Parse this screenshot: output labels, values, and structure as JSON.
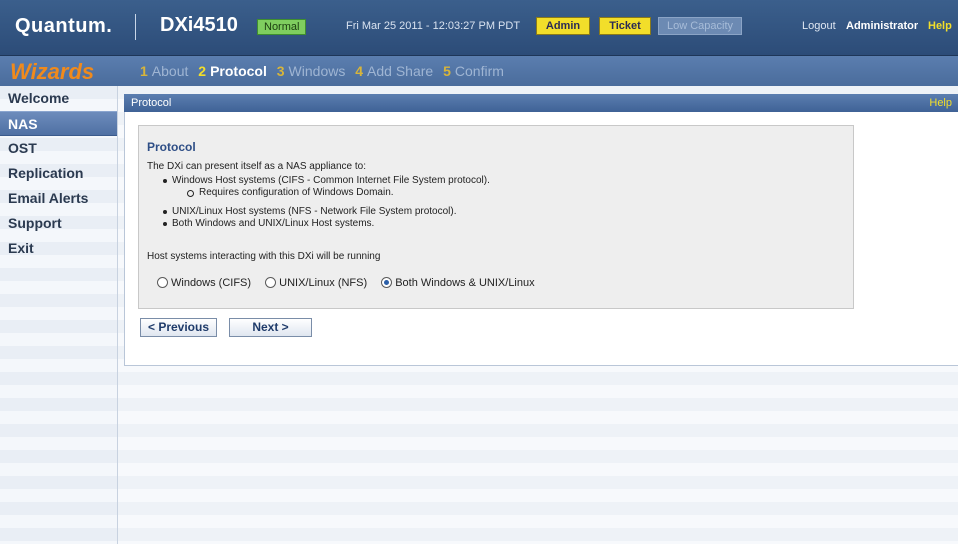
{
  "header": {
    "brand": "Quantum.",
    "model": "DXi4510",
    "status": "Normal",
    "datetime": "Fri Mar 25 2011 - 12:03:27 PM PDT",
    "buttons": {
      "admin": "Admin",
      "ticket": "Ticket",
      "low_capacity": "Low Capacity"
    },
    "logout": "Logout",
    "user": "Administrator",
    "help": "Help"
  },
  "wizard": {
    "title": "Wizards",
    "steps": [
      {
        "num": "1",
        "label": "About"
      },
      {
        "num": "2",
        "label": "Protocol"
      },
      {
        "num": "3",
        "label": "Windows"
      },
      {
        "num": "4",
        "label": "Add Share"
      },
      {
        "num": "5",
        "label": "Confirm"
      }
    ],
    "active_step": "Protocol"
  },
  "sidebar": {
    "items": [
      {
        "label": "Welcome"
      },
      {
        "label": "NAS"
      },
      {
        "label": "OST"
      },
      {
        "label": "Replication"
      },
      {
        "label": "Email Alerts"
      },
      {
        "label": "Support"
      },
      {
        "label": "Exit"
      }
    ],
    "active_item": "NAS"
  },
  "panel": {
    "title": "Protocol",
    "help": "Help",
    "heading": "Protocol",
    "intro": "The DXi can present itself as a NAS appliance to:",
    "bullets": {
      "windows": "Windows Host systems (CIFS - Common Internet File System protocol).",
      "windows_sub": "Requires configuration of Windows Domain.",
      "unix": "UNIX/Linux Host systems (NFS - Network File System protocol).",
      "both": "Both Windows and UNIX/Linux Host systems."
    },
    "running_text": "Host systems interacting with this DXi will be running",
    "options": [
      {
        "label": "Windows (CIFS)",
        "checked": false
      },
      {
        "label": "UNIX/Linux (NFS)",
        "checked": false
      },
      {
        "label": "Both Windows & UNIX/Linux",
        "checked": true
      }
    ],
    "prev_label": "< Previous",
    "next_label": "Next >"
  },
  "colors": {
    "header_blue": "#2c4c78",
    "wizard_orange": "#f08a1c",
    "badge_green": "#7fce5f",
    "button_yellow": "#f2de2a",
    "heading_blue": "#2e4e86"
  }
}
